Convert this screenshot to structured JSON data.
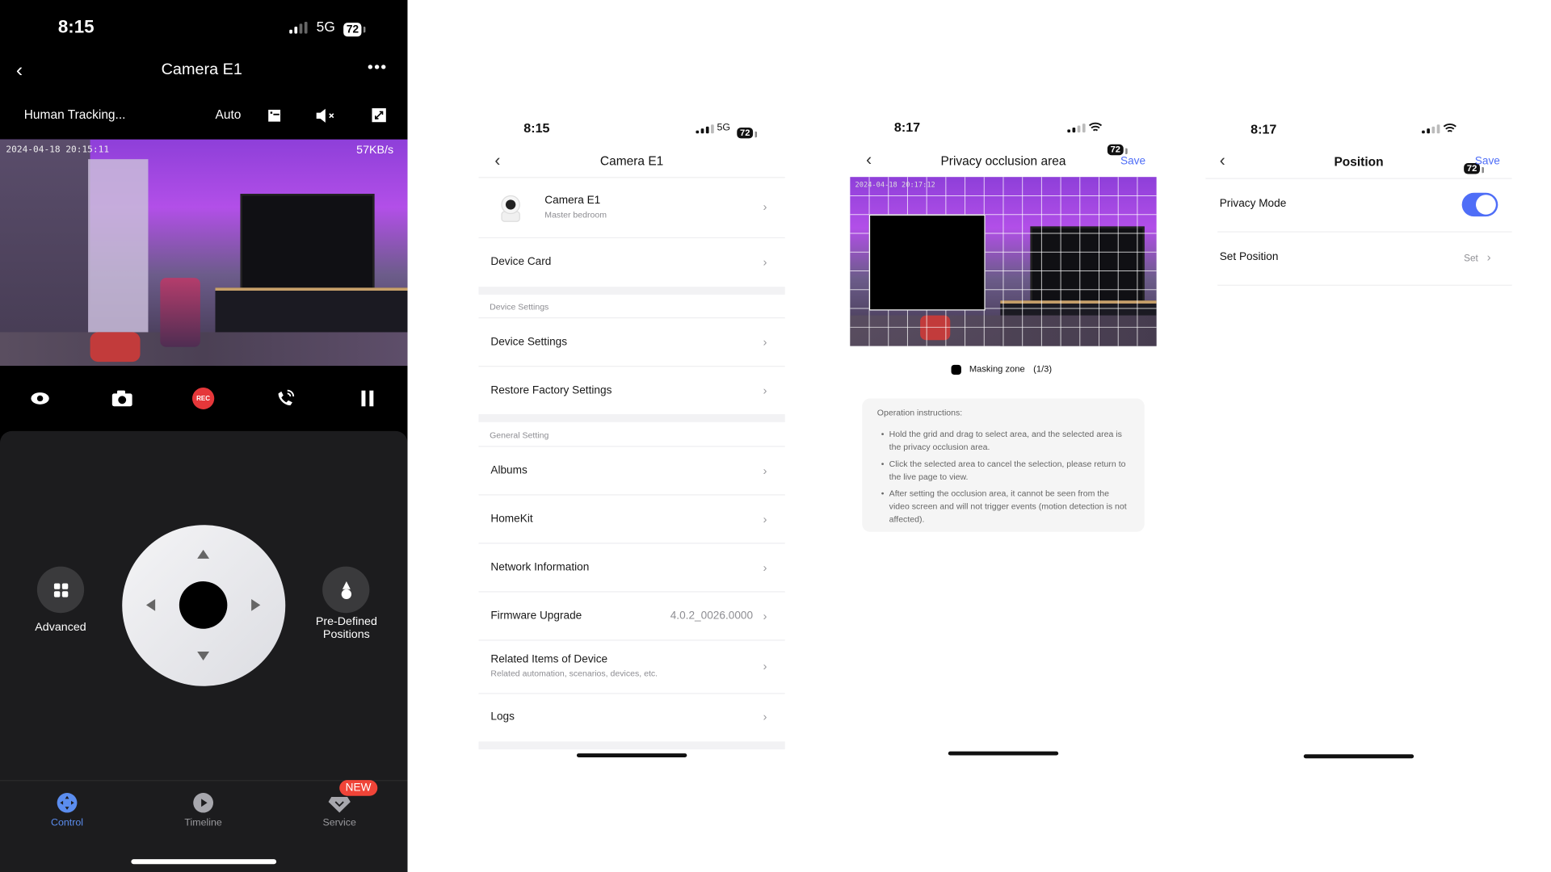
{
  "screens": {
    "live": {
      "status": {
        "time": "8:15",
        "network": "5G",
        "battery": "72"
      },
      "title": "Camera E1",
      "toolbar": {
        "tracking": "Human Tracking...",
        "quality": "Auto"
      },
      "video": {
        "timestamp": "2024-04-18 20:15:11",
        "bitrate": "57KB/s"
      },
      "controls": {
        "rec_label": "REC"
      },
      "ptz": {
        "advanced_label": "Advanced",
        "predefined_label_line1": "Pre-Defined",
        "predefined_label_line2": "Positions"
      },
      "tabs": [
        {
          "label": "Control",
          "active": true
        },
        {
          "label": "Timeline",
          "active": false
        },
        {
          "label": "Service",
          "active": false,
          "badge": "NEW"
        }
      ],
      "colors": {
        "accent": "#5b8def",
        "rec": "#e5373a",
        "badge": "#f04438"
      }
    },
    "settings": {
      "status": {
        "time": "8:15",
        "network": "5G",
        "battery": "72"
      },
      "title": "Camera E1",
      "device": {
        "name": "Camera E1",
        "room": "Master bedroom"
      },
      "rows_top": [
        {
          "label": "Device Card"
        }
      ],
      "section_device": "Device Settings",
      "rows_device": [
        {
          "label": "Device Settings"
        },
        {
          "label": "Restore Factory Settings"
        }
      ],
      "section_general": "General Setting",
      "rows_general": [
        {
          "label": "Albums"
        },
        {
          "label": "HomeKit"
        },
        {
          "label": "Network Information"
        },
        {
          "label": "Firmware Upgrade",
          "value": "4.0.2_0026.0000"
        },
        {
          "label": "Related Items of Device",
          "sub": "Related automation, scenarios, devices, etc."
        },
        {
          "label": "Logs"
        }
      ]
    },
    "privacy": {
      "status": {
        "time": "8:17",
        "battery": "72"
      },
      "title": "Privacy occlusion area",
      "save": "Save",
      "video_timestamp": "2024-04-18 20:17:12",
      "legend": "Masking zone",
      "legend_count": "(1/3)",
      "instructions_title": "Operation instructions:",
      "instructions": [
        "Hold the grid and drag to select area, and the selected area is the privacy occlusion area.",
        "Click the selected area to cancel the selection, please return to the live page to view.",
        "After setting the occlusion area, it cannot be seen from the video screen and will not trigger events (motion detection is not affected)."
      ],
      "colors": {
        "save": "#4f6ef7"
      }
    },
    "position": {
      "status": {
        "time": "8:17",
        "battery": "72"
      },
      "title": "Position",
      "save": "Save",
      "privacy_mode_label": "Privacy Mode",
      "privacy_mode_on": true,
      "set_position_label": "Set Position",
      "set_position_value": "Set",
      "colors": {
        "toggle": "#4f6ef7"
      }
    }
  }
}
